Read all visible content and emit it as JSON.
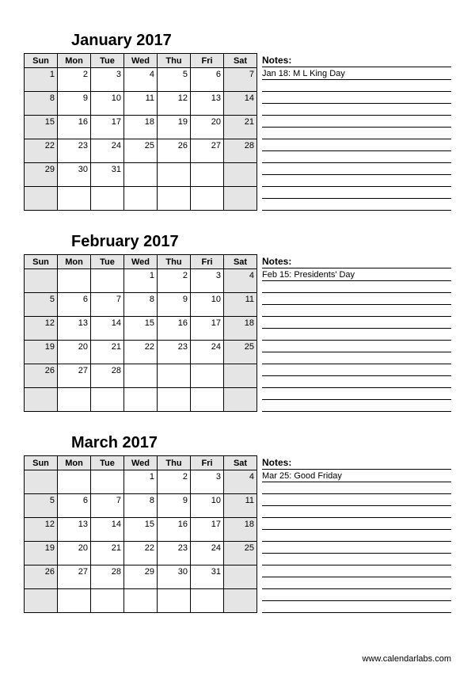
{
  "day_headers": [
    "Sun",
    "Mon",
    "Tue",
    "Wed",
    "Thu",
    "Fri",
    "Sat"
  ],
  "notes_label": "Notes:",
  "footer": "www.calendarlabs.com",
  "months": [
    {
      "title": "January 2017",
      "note": "Jan 18: M L King Day",
      "weeks": [
        [
          {
            "n": "1",
            "s": true
          },
          {
            "n": "2"
          },
          {
            "n": "3"
          },
          {
            "n": "4"
          },
          {
            "n": "5"
          },
          {
            "n": "6"
          },
          {
            "n": "7",
            "s": true
          }
        ],
        [
          {
            "n": "8",
            "s": true
          },
          {
            "n": "9"
          },
          {
            "n": "10"
          },
          {
            "n": "11"
          },
          {
            "n": "12"
          },
          {
            "n": "13"
          },
          {
            "n": "14",
            "s": true
          }
        ],
        [
          {
            "n": "15",
            "s": true
          },
          {
            "n": "16"
          },
          {
            "n": "17"
          },
          {
            "n": "18"
          },
          {
            "n": "19"
          },
          {
            "n": "20"
          },
          {
            "n": "21",
            "s": true
          }
        ],
        [
          {
            "n": "22",
            "s": true
          },
          {
            "n": "23"
          },
          {
            "n": "24"
          },
          {
            "n": "25"
          },
          {
            "n": "26"
          },
          {
            "n": "27"
          },
          {
            "n": "28",
            "s": true
          }
        ],
        [
          {
            "n": "29",
            "s": true
          },
          {
            "n": "30"
          },
          {
            "n": "31"
          },
          {
            "n": ""
          },
          {
            "n": ""
          },
          {
            "n": ""
          },
          {
            "n": "",
            "s": true
          }
        ],
        [
          {
            "n": "",
            "s": true
          },
          {
            "n": ""
          },
          {
            "n": ""
          },
          {
            "n": ""
          },
          {
            "n": ""
          },
          {
            "n": ""
          },
          {
            "n": "",
            "s": true
          }
        ]
      ]
    },
    {
      "title": "February 2017",
      "note": "Feb 15: Presidents' Day",
      "weeks": [
        [
          {
            "n": "",
            "s": true
          },
          {
            "n": ""
          },
          {
            "n": ""
          },
          {
            "n": "1"
          },
          {
            "n": "2"
          },
          {
            "n": "3"
          },
          {
            "n": "4",
            "s": true
          }
        ],
        [
          {
            "n": "5",
            "s": true
          },
          {
            "n": "6"
          },
          {
            "n": "7"
          },
          {
            "n": "8"
          },
          {
            "n": "9"
          },
          {
            "n": "10"
          },
          {
            "n": "11",
            "s": true
          }
        ],
        [
          {
            "n": "12",
            "s": true
          },
          {
            "n": "13"
          },
          {
            "n": "14"
          },
          {
            "n": "15"
          },
          {
            "n": "16"
          },
          {
            "n": "17"
          },
          {
            "n": "18",
            "s": true
          }
        ],
        [
          {
            "n": "19",
            "s": true
          },
          {
            "n": "20"
          },
          {
            "n": "21"
          },
          {
            "n": "22"
          },
          {
            "n": "23"
          },
          {
            "n": "24"
          },
          {
            "n": "25",
            "s": true
          }
        ],
        [
          {
            "n": "26",
            "s": true
          },
          {
            "n": "27"
          },
          {
            "n": "28"
          },
          {
            "n": ""
          },
          {
            "n": ""
          },
          {
            "n": ""
          },
          {
            "n": "",
            "s": true
          }
        ],
        [
          {
            "n": "",
            "s": true
          },
          {
            "n": ""
          },
          {
            "n": ""
          },
          {
            "n": ""
          },
          {
            "n": ""
          },
          {
            "n": ""
          },
          {
            "n": "",
            "s": true
          }
        ]
      ]
    },
    {
      "title": "March 2017",
      "note": "Mar 25: Good Friday",
      "weeks": [
        [
          {
            "n": "",
            "s": true
          },
          {
            "n": ""
          },
          {
            "n": ""
          },
          {
            "n": "1"
          },
          {
            "n": "2"
          },
          {
            "n": "3"
          },
          {
            "n": "4",
            "s": true
          }
        ],
        [
          {
            "n": "5",
            "s": true
          },
          {
            "n": "6"
          },
          {
            "n": "7"
          },
          {
            "n": "8"
          },
          {
            "n": "9"
          },
          {
            "n": "10"
          },
          {
            "n": "11",
            "s": true
          }
        ],
        [
          {
            "n": "12",
            "s": true
          },
          {
            "n": "13"
          },
          {
            "n": "14"
          },
          {
            "n": "15"
          },
          {
            "n": "16"
          },
          {
            "n": "17"
          },
          {
            "n": "18",
            "s": true
          }
        ],
        [
          {
            "n": "19",
            "s": true
          },
          {
            "n": "20"
          },
          {
            "n": "21"
          },
          {
            "n": "22"
          },
          {
            "n": "23"
          },
          {
            "n": "24"
          },
          {
            "n": "25",
            "s": true
          }
        ],
        [
          {
            "n": "26",
            "s": true
          },
          {
            "n": "27"
          },
          {
            "n": "28"
          },
          {
            "n": "29"
          },
          {
            "n": "30"
          },
          {
            "n": "31"
          },
          {
            "n": "",
            "s": true
          }
        ],
        [
          {
            "n": "",
            "s": true
          },
          {
            "n": ""
          },
          {
            "n": ""
          },
          {
            "n": ""
          },
          {
            "n": ""
          },
          {
            "n": ""
          },
          {
            "n": "",
            "s": true
          }
        ]
      ]
    }
  ]
}
